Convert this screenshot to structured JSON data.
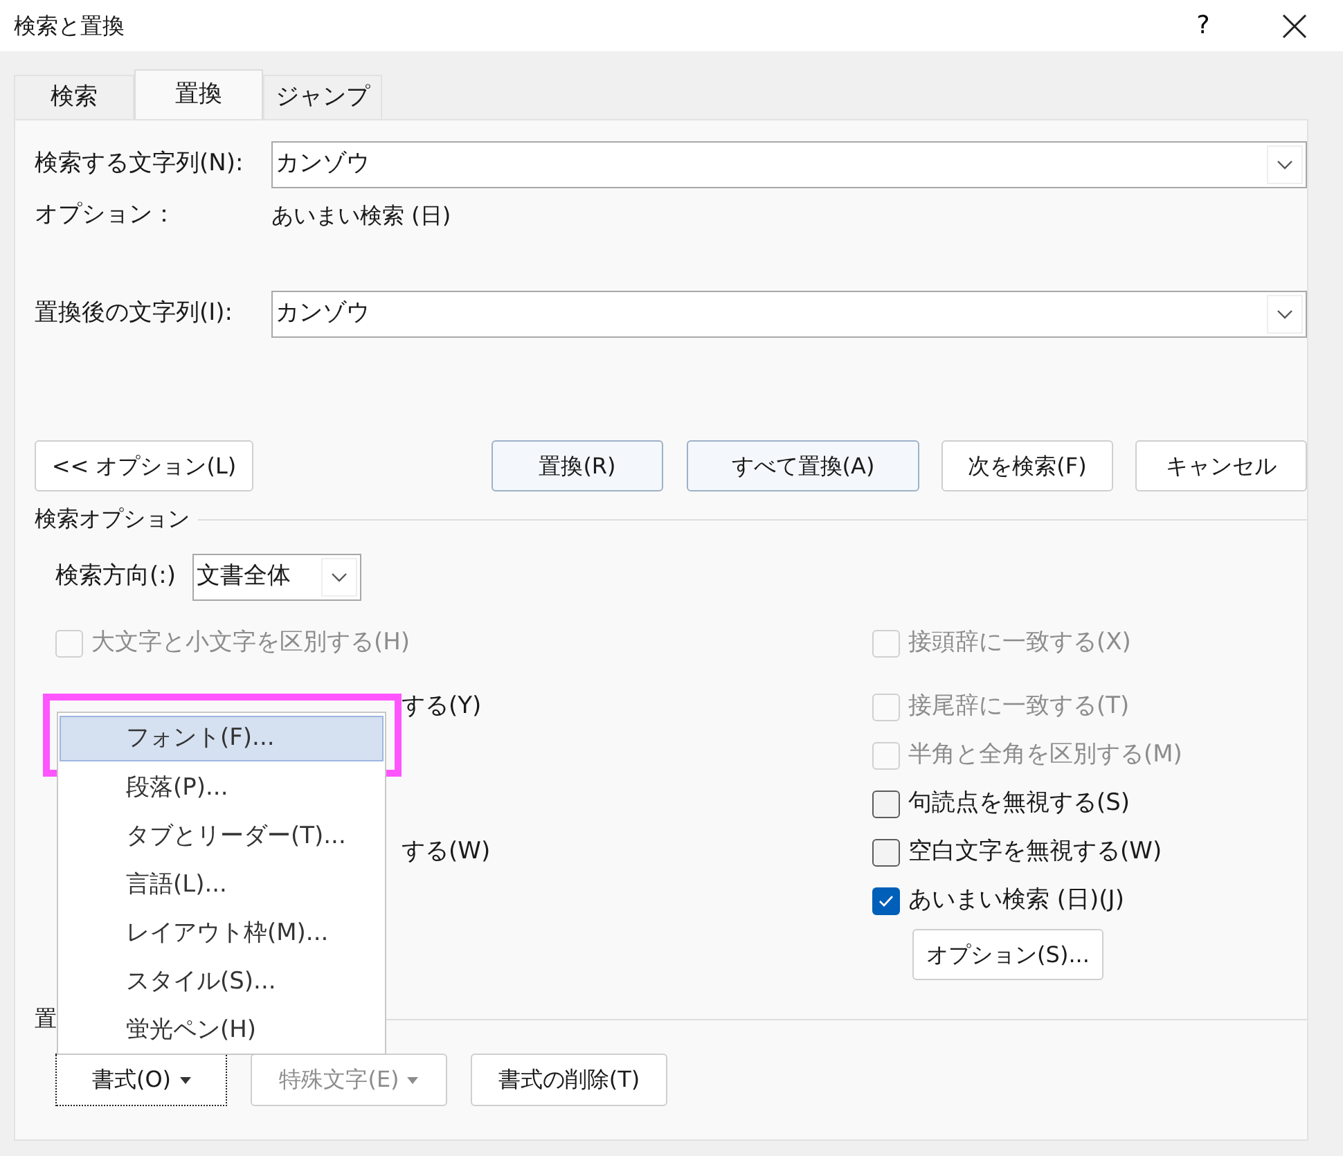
{
  "window": {
    "title": "検索と置換",
    "help": "?"
  },
  "tabs": [
    {
      "label": "検索",
      "selected": false
    },
    {
      "label": "置換",
      "selected": true
    },
    {
      "label": "ジャンプ",
      "selected": false
    }
  ],
  "find": {
    "label": "検索する文字列(N):",
    "value": "カンゾウ"
  },
  "find_options": {
    "label": "オプション：",
    "value": "あいまい検索 (日)"
  },
  "replace": {
    "label": "置換後の文字列(I):",
    "value": "カンゾウ"
  },
  "buttons": [
    {
      "label": "<< オプション(L)",
      "default": false
    },
    {
      "label": "置換(R)",
      "default": true
    },
    {
      "label": "すべて置換(A)",
      "default": true
    },
    {
      "label": "次を検索(F)",
      "default": false
    },
    {
      "label": "キャンセル",
      "default": false
    }
  ],
  "search_options": {
    "title": "検索オプション",
    "direction_label": "検索方向(:)",
    "direction_value": "文書全体"
  },
  "left_options": [
    {
      "kind": "checkbox",
      "label": "大文字と小文字を区別する(H)",
      "checked": false,
      "disabled": true
    },
    {
      "kind": "partial",
      "label": "する(Y)"
    },
    {
      "kind": "partial",
      "label": "する(W)"
    }
  ],
  "right_options": [
    {
      "label": "接頭辞に一致する(X)",
      "checked": false,
      "disabled": true
    },
    {
      "label": "接尾辞に一致する(T)",
      "checked": false,
      "disabled": true
    },
    {
      "label": "半角と全角を区別する(M)",
      "checked": false,
      "disabled": true
    },
    {
      "label": "句読点を無視する(S)",
      "checked": false,
      "disabled": false
    },
    {
      "label": "空白文字を無視する(W)",
      "checked": false,
      "disabled": false
    },
    {
      "label": "あいまい検索 (日)(J)",
      "checked": true,
      "disabled": false
    }
  ],
  "options_button": "オプション(S)...",
  "replace_section": {
    "title": "置"
  },
  "bottom_buttons": [
    {
      "label": "書式(O)",
      "dropdown": true,
      "disabled": false,
      "focused": true
    },
    {
      "label": "特殊文字(E)",
      "dropdown": true,
      "disabled": true,
      "focused": false
    },
    {
      "label": "書式の削除(T)",
      "dropdown": false,
      "disabled": false,
      "focused": false
    }
  ],
  "format_menu": [
    {
      "label": "フォント(F)...",
      "highlighted": true,
      "annotated": true
    },
    {
      "label": "段落(P)...",
      "highlighted": false,
      "annotated": false
    },
    {
      "label": "タブとリーダー(T)...",
      "highlighted": false,
      "annotated": false
    },
    {
      "label": "言語(L)...",
      "highlighted": false,
      "annotated": false
    },
    {
      "label": "レイアウト枠(M)...",
      "highlighted": false,
      "annotated": false
    },
    {
      "label": "スタイル(S)...",
      "highlighted": false,
      "annotated": false
    },
    {
      "label": "蛍光ペン(H)",
      "highlighted": false,
      "annotated": false
    }
  ]
}
